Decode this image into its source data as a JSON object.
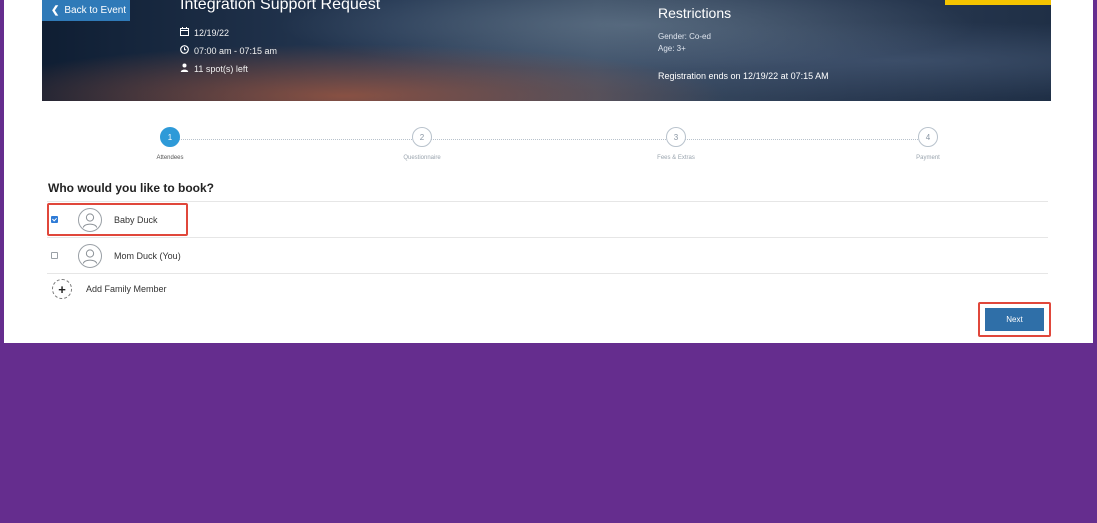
{
  "hero": {
    "back_label": "Back to Event",
    "title": "Integration Support Request",
    "date": "12/19/22",
    "time": "07:00 am - 07:15 am",
    "spots": "11 spot(s) left",
    "restrictions_title": "Restrictions",
    "gender": "Gender: Co-ed",
    "age": "Age: 3+",
    "registration_ends": "Registration ends on 12/19/22 at 07:15 AM"
  },
  "steps": [
    {
      "number": "1",
      "label": "Attendees",
      "active": true
    },
    {
      "number": "2",
      "label": "Questionnaire",
      "active": false
    },
    {
      "number": "3",
      "label": "Fees & Extras",
      "active": false
    },
    {
      "number": "4",
      "label": "Payment",
      "active": false
    }
  ],
  "booking": {
    "question": "Who would you like to book?",
    "attendees": [
      {
        "name": "Baby Duck",
        "checked": true
      },
      {
        "name": "Mom Duck (You)",
        "checked": false
      }
    ],
    "add_member_label": "Add Family Member",
    "next_label": "Next"
  },
  "colors": {
    "brand_purple": "#652d8e",
    "accent_blue": "#2f7ab8",
    "step_active": "#2e9ad8",
    "highlight_red": "#e0473b"
  },
  "icons": {
    "back": "chevron-left-icon",
    "date": "calendar-icon",
    "time": "clock-icon",
    "spots": "person-icon",
    "avatar": "user-avatar-icon",
    "add": "plus-circle-icon"
  }
}
